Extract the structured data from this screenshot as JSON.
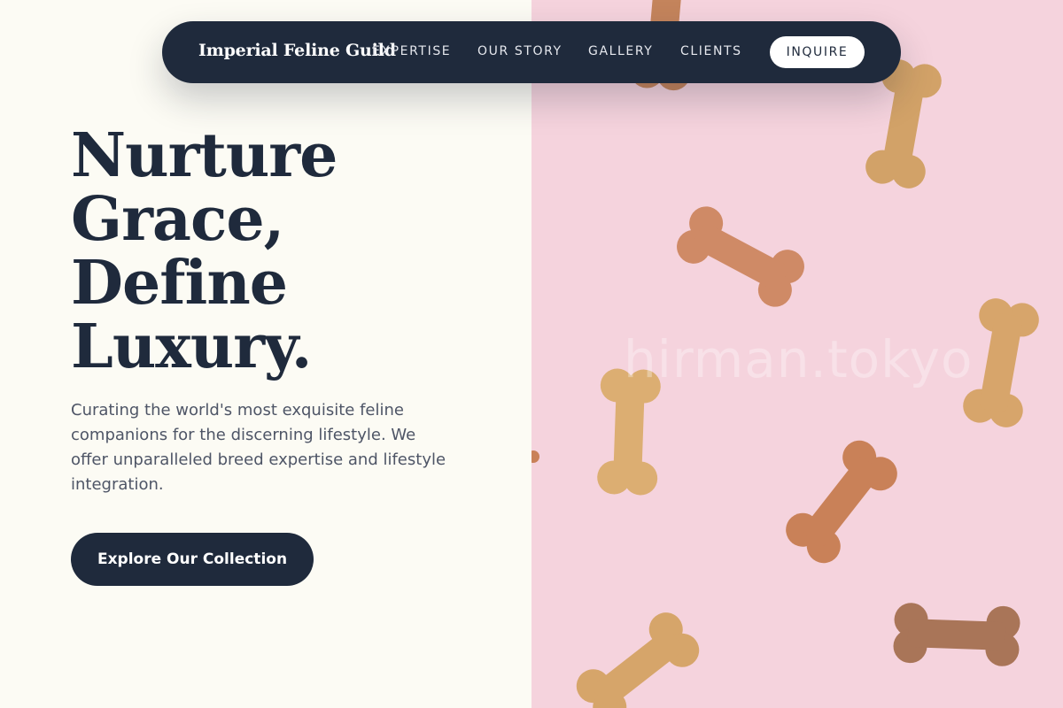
{
  "nav": {
    "brand": "Imperial Feline Guild",
    "links": [
      "EXPERTISE",
      "OUR STORY",
      "GALLERY",
      "CLIENTS"
    ],
    "cta": "INQUIRE"
  },
  "hero": {
    "title_lines": [
      "Nurture",
      "Grace,",
      "Define",
      "Luxury."
    ],
    "subtitle": "Curating the world's most exquisite feline companions for the discerning lifestyle. We offer unparalleled breed expertise and lifestyle integration.",
    "button": "Explore Our Collection"
  },
  "image": {
    "watermark": "hirman.tokyo",
    "subject": "dog-bone-biscuits"
  },
  "colors": {
    "navy": "#1f2a3c",
    "cream": "#fcfbf4",
    "pink": "#f5d3dd",
    "body_text": "#4e5566"
  }
}
